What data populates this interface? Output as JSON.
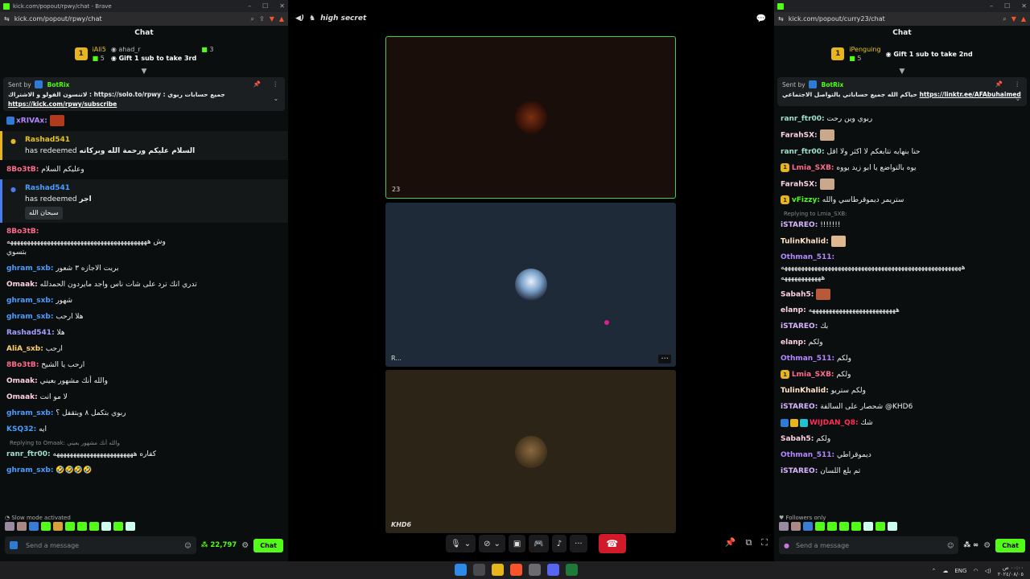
{
  "left_window": {
    "url": "kick.com/popout/rpwy/chat - Brave",
    "address": "kick.com/popout/rpwy/chat",
    "chat_title": "Chat",
    "top_gifters": [
      {
        "rank": "1",
        "name": "iAli5",
        "count": "5"
      },
      {
        "name": "ahad_r",
        "count": "3"
      }
    ],
    "gift_text": "Gift 1 sub to take 3rd",
    "pinned": {
      "sent_by": "Sent by",
      "bot": "BotRix",
      "text": "لاتنسون الفولو و الاشتراك : https://solo.to/rpwy : جميع حسابات ربوي",
      "link": "https://kick.com/rpwy/subscribe"
    },
    "messages": [
      {
        "user": "xRIVAx:",
        "text": "",
        "color": "#b388ff"
      },
      {
        "user": "8Bo3tB:",
        "text": "وعليكم السلام",
        "color": "#ff6b8b"
      },
      {
        "user": "8Bo3tB:",
        "text": "وش ههههههههههههههههههههههههههههههههههههههههههه",
        "text2": "بتسوي",
        "color": "#ff6b8b"
      },
      {
        "user": "ghram_sxb:",
        "text": "بريت الاجازه ٣ شعور",
        "color": "#4a9eff"
      },
      {
        "user": "Omaak:",
        "text": "تدري انك ترد على شات ناس واجد مايردون الحمدلله",
        "color": "#ffd1e0"
      },
      {
        "user": "ghram_sxb:",
        "text": "شهور",
        "color": "#4a9eff"
      },
      {
        "user": "ghram_sxb:",
        "text": "هلا ارحب",
        "color": "#4a9eff"
      },
      {
        "user": "Rashad541:",
        "text": "هلا",
        "color": "#a0a0ff"
      },
      {
        "user": "AliA_sxb:",
        "text": "ارحب",
        "color": "#ffd166"
      },
      {
        "user": "8Bo3tB:",
        "text": "ارحب يا الشيخ",
        "color": "#ff6b8b"
      },
      {
        "user": "Omaak:",
        "text": "والله أنك مشهور بعيني",
        "color": "#ffd1e0"
      },
      {
        "user": "Omaak:",
        "text": "لا مو انت",
        "color": "#ffd1e0"
      },
      {
        "user": "ghram_sxb:",
        "text": "ربوي بتكمل ٨ وبتقفل ؟",
        "color": "#4a9eff"
      },
      {
        "user": "KSQ32:",
        "text": "ايه",
        "color": "#4a9eff"
      },
      {
        "user": "ranr_ftr00:",
        "text": "كفاره ههههههههههههههههههههههههه",
        "color": "#9de0c9",
        "reply": "Replying to Omaak: والله أنك مشهور بعيني"
      },
      {
        "user": "ghram_sxb:",
        "text": "🤣🤣🤣🤣",
        "color": "#4a9eff"
      }
    ],
    "redeem1": {
      "user": "Rashad541",
      "action": "has redeemed",
      "text": "السلام عليكم ورحمة الله وبركاته"
    },
    "redeem2": {
      "user": "Rashad541",
      "action": "has redeemed",
      "text": "اجر",
      "chip": "سبحان الله"
    },
    "slow_mode": "Slow mode activated",
    "input_placeholder": "Send a message",
    "points": "22,797",
    "chat_button": "Chat"
  },
  "center": {
    "title": "high secret",
    "tile1_label": "23",
    "tile2_label": "R...",
    "tile3_label": "KHD6"
  },
  "right_window": {
    "address": "kick.com/popout/curry23/chat",
    "chat_title": "Chat",
    "top_gifter": {
      "rank": "1",
      "name": "iPenguing",
      "count": "5"
    },
    "gift_text": "Gift 1 sub to take 2nd",
    "pinned": {
      "sent_by": "Sent by",
      "bot": "BotRix",
      "text": "حياكم الله جميع حساباتي بالتواصل الاجتماعي",
      "link": "https://linktr.ee/AFAbuhaimed"
    },
    "messages": [
      {
        "user": "ranr_ftr00:",
        "text": "ربوي وين رحت",
        "color": "#9de0c9"
      },
      {
        "user": "FarahSX:",
        "text": "",
        "color": "#ffd1e0",
        "emote": true
      },
      {
        "user": "ranr_ftr00:",
        "text": "حنا بنهايه نتابعكم لا اكثر ولا اقل",
        "color": "#9de0c9"
      },
      {
        "user": "Lmia_SXB:",
        "text": "يوه بالتواضع يا ابو زيد يووه",
        "color": "#ff6b8b"
      },
      {
        "user": "FarahSX:",
        "text": "",
        "color": "#ffd1e0",
        "emote": true
      },
      {
        "user": "vFizzy:",
        "text": "ستريمر ديموقرطاسي والله",
        "color": "#53fc18"
      },
      {
        "user": "iSTAREO:",
        "text": "!!!!!!!",
        "color": "#d8b4fe",
        "reply": "Replying to Lmia_SXB:"
      },
      {
        "user": "TulinKhalid:",
        "text": "",
        "color": "#ffe4c4",
        "emote": true
      },
      {
        "user": "Othman_511:",
        "text": "ههههههههههههههههههههههههههههههههههههههههههههههههههههههه",
        "text2": "ههههههههههههه",
        "color": "#b388ff"
      },
      {
        "user": "Sabah5:",
        "text": "",
        "color": "#ffd1e0",
        "emote": true
      },
      {
        "user": "elanp:",
        "text": "ههههههههههههههههههههههههههه",
        "color": "#ffd1e0"
      },
      {
        "user": "iSTAREO:",
        "text": "بك",
        "color": "#d8b4fe"
      },
      {
        "user": "elanp:",
        "text": "ولكم",
        "color": "#ffd1e0"
      },
      {
        "user": "Othman_511:",
        "text": "ولكم",
        "color": "#b388ff"
      },
      {
        "user": "Lmia_SXB:",
        "text": "ولكم",
        "color": "#ff6b8b"
      },
      {
        "user": "TulinKhalid:",
        "text": "ولكم ستريو",
        "color": "#ffe4c4"
      },
      {
        "user": "iSTAREO:",
        "text": "شحصار على السالفة @KHD6",
        "color": "#d8b4fe"
      },
      {
        "user": "WIJDAN_Q8:",
        "text": "شك",
        "color": "#ff2d55"
      },
      {
        "user": "Sabah5:",
        "text": "ولكم",
        "color": "#ffd1e0"
      },
      {
        "user": "Othman_511:",
        "text": "ديموقراطي",
        "color": "#b388ff"
      },
      {
        "user": "iSTAREO:",
        "text": "تم بلع اللسان",
        "color": "#d8b4fe"
      }
    ],
    "followers_only": "Followers only",
    "input_placeholder": "Send a message",
    "points": "∞",
    "chat_button": "Chat"
  },
  "taskbar": {
    "lang": "ENG",
    "time": "٠٠:٠٠ ص",
    "date": "٢٠٢٤/٠٨/٠٥"
  }
}
